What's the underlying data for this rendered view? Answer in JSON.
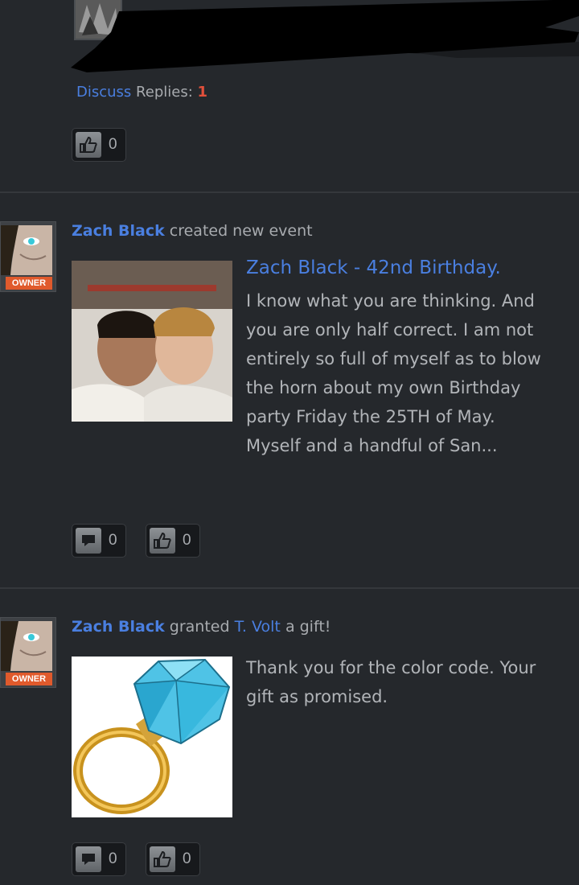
{
  "top_item": {
    "discuss_label": "Discuss",
    "replies_label": "Replies:",
    "replies_count": "1",
    "like_count": "0"
  },
  "event_item": {
    "actor": "Zach Black",
    "action": "created new event",
    "badge": "OWNER",
    "event_title": "Zach Black - 42nd Birthday.",
    "description": "I know what you are thinking. And you are only half correct. I am not entirely so full of myself as to blow the horn about my own Birthday party Friday the 25TH of May. Myself and a handful of San...",
    "comment_count": "0",
    "like_count": "0"
  },
  "gift_item": {
    "actor": "Zach Black",
    "action": "granted",
    "recipient": "T. Volt",
    "action_suffix": "a gift!",
    "badge": "OWNER",
    "message": "Thank you for the color code. Your gift as promised.",
    "comment_count": "0",
    "like_count": "0"
  },
  "colors": {
    "background": "#25282c",
    "link": "#4a7fe0",
    "badge": "#e05a2c",
    "replies_count": "#e2503b"
  },
  "icons": [
    "like-thumb-icon",
    "comment-bubble-icon"
  ]
}
